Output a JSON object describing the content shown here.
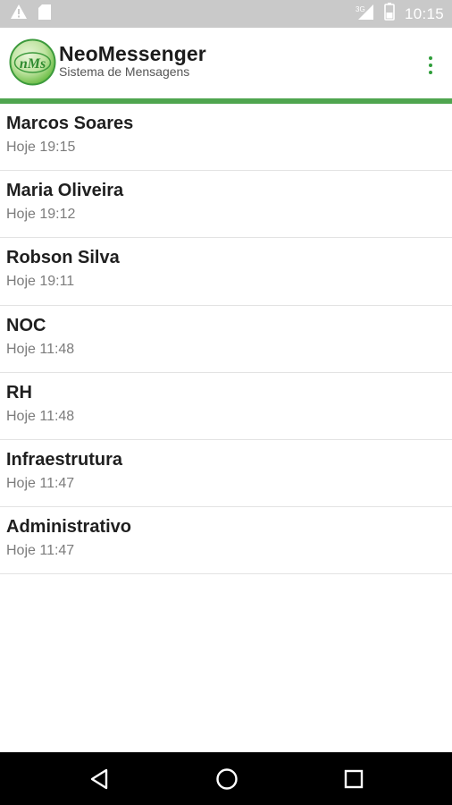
{
  "status_bar": {
    "time": "10:15",
    "network_label": "3G",
    "icons": [
      "warning-icon",
      "sd-card-icon",
      "signal-icon",
      "battery-icon"
    ]
  },
  "app_bar": {
    "logo_text": "nMs",
    "title": "NeoMessenger",
    "subtitle": "Sistema de Mensagens",
    "menu_icon": "overflow-menu-icon"
  },
  "colors": {
    "accent": "#4fa54f",
    "status_bar": "#c9c9c9",
    "nav_bar": "#000000"
  },
  "conversations": [
    {
      "name": "Marcos Soares",
      "time": "Hoje 19:15"
    },
    {
      "name": "Maria Oliveira",
      "time": "Hoje 19:12"
    },
    {
      "name": "Robson Silva",
      "time": "Hoje 19:11"
    },
    {
      "name": "NOC",
      "time": "Hoje 11:48"
    },
    {
      "name": "RH",
      "time": "Hoje 11:48"
    },
    {
      "name": "Infraestrutura",
      "time": "Hoje 11:47"
    },
    {
      "name": "Administrativo",
      "time": "Hoje 11:47"
    }
  ],
  "nav_bar": {
    "icons": [
      "back-icon",
      "home-icon",
      "recents-icon"
    ]
  }
}
